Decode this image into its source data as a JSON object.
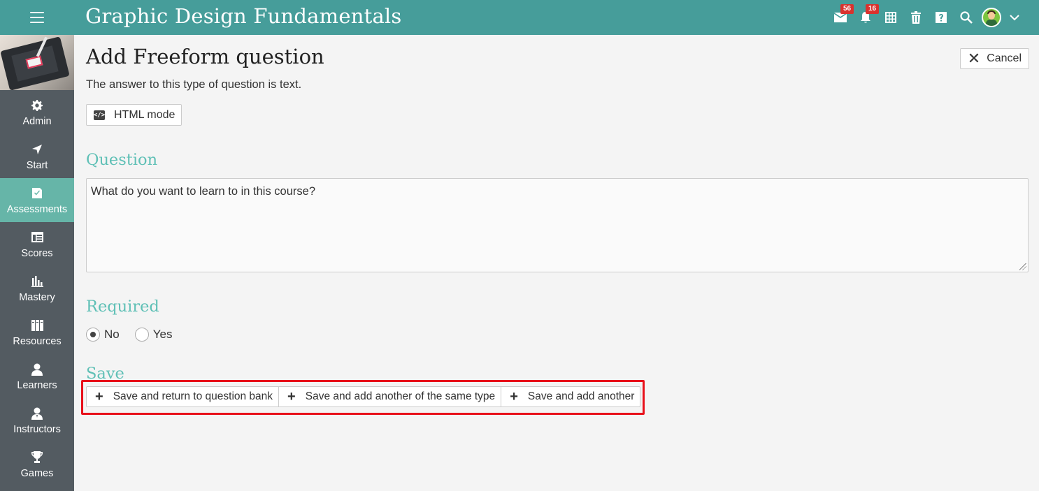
{
  "topbar": {
    "title": "Graphic Design Fundamentals",
    "icons": [
      {
        "name": "messages-icon",
        "badge": "56"
      },
      {
        "name": "notifications-icon",
        "badge": "16"
      },
      {
        "name": "calendar-icon"
      },
      {
        "name": "trash-icon"
      },
      {
        "name": "help-icon"
      },
      {
        "name": "search-icon"
      }
    ],
    "colors": {
      "bar": "#469d9a",
      "badge": "#d9322e"
    }
  },
  "sidebar": {
    "items": [
      {
        "label": "Admin",
        "icon": "gear-icon"
      },
      {
        "label": "Start",
        "icon": "navigation-arrow-icon"
      },
      {
        "label": "Assessments",
        "icon": "checkbox-icon",
        "active": true
      },
      {
        "label": "Scores",
        "icon": "gradebook-icon"
      },
      {
        "label": "Mastery",
        "icon": "bar-chart-icon"
      },
      {
        "label": "Resources",
        "icon": "books-icon"
      },
      {
        "label": "Learners",
        "icon": "person-icon"
      },
      {
        "label": "Instructors",
        "icon": "instructor-icon"
      },
      {
        "label": "Games",
        "icon": "trophy-icon"
      }
    ],
    "colors": {
      "background": "#535b61",
      "active": "#66b5a8"
    }
  },
  "main": {
    "title": "Add Freeform question",
    "cancel_label": "Cancel",
    "subtitle": "The answer to this type of question is text.",
    "html_mode_label": "HTML mode",
    "question_section": "Question",
    "question_text": "What do you want to learn to in this course?",
    "required_section": "Required",
    "required_options": [
      {
        "label": "No",
        "selected": true
      },
      {
        "label": "Yes",
        "selected": false
      }
    ],
    "save_section": "Save",
    "save_buttons": [
      {
        "label": "Save and return to question bank"
      },
      {
        "label": "Save and add another of the same type"
      },
      {
        "label": "Save and add another"
      }
    ],
    "colors": {
      "section_heading": "#5fc0b6",
      "highlight": "#e8101a"
    }
  }
}
